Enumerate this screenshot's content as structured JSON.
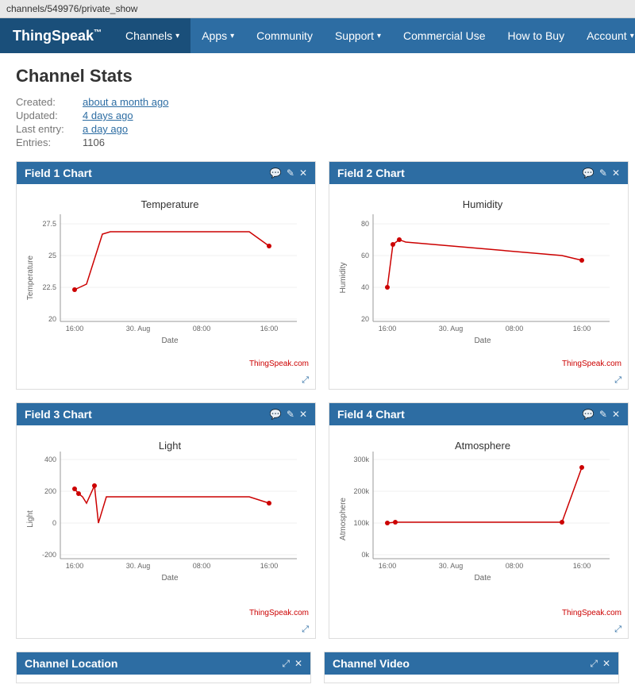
{
  "browser": {
    "url": "channels/549976/private_show"
  },
  "navbar": {
    "brand": "ThingSpeak",
    "brand_tm": "™",
    "items": [
      {
        "label": "Channels",
        "has_dropdown": true,
        "active": false
      },
      {
        "label": "Apps",
        "has_dropdown": true,
        "active": false
      },
      {
        "label": "Community",
        "has_dropdown": false,
        "active": false
      },
      {
        "label": "Support",
        "has_dropdown": true,
        "active": false
      }
    ],
    "right_items": [
      {
        "label": "Commercial Use",
        "has_dropdown": false
      },
      {
        "label": "How to Buy",
        "has_dropdown": false
      },
      {
        "label": "Account",
        "has_dropdown": true
      }
    ]
  },
  "page": {
    "title": "Channel Stats",
    "stats": [
      {
        "label": "Created:",
        "value": "about a month ago",
        "linked": true
      },
      {
        "label": "Updated:",
        "value": "4 days ago",
        "linked": true
      },
      {
        "label": "Last entry:",
        "value": "a day ago",
        "linked": true
      },
      {
        "label": "Entries:",
        "value": "1106",
        "linked": false
      }
    ]
  },
  "charts": [
    {
      "id": "field1",
      "title": "Field 1 Chart",
      "graph_title": "Temperature",
      "y_label": "Temperature",
      "x_label": "Date",
      "credit": "ThingSpeak.com",
      "y_ticks": [
        "27.5",
        "25",
        "22.5",
        "20"
      ],
      "x_ticks": [
        "16:00",
        "30. Aug",
        "08:00",
        "16:00"
      ],
      "data_points": [
        {
          "x": 60,
          "y": 285
        },
        {
          "x": 75,
          "y": 280
        },
        {
          "x": 110,
          "y": 250
        },
        {
          "x": 120,
          "y": 248
        },
        {
          "x": 315,
          "y": 248
        },
        {
          "x": 330,
          "y": 260
        }
      ]
    },
    {
      "id": "field2",
      "title": "Field 2 Chart",
      "graph_title": "Humidity",
      "y_label": "Humidity",
      "x_label": "Date",
      "credit": "ThingSpeak.com",
      "y_ticks": [
        "80",
        "60",
        "40",
        "20"
      ],
      "x_ticks": [
        "16:00",
        "30. Aug",
        "08:00",
        "16:00"
      ],
      "data_points": [
        {
          "x": 55,
          "y": 295
        },
        {
          "x": 65,
          "y": 240
        },
        {
          "x": 75,
          "y": 235
        },
        {
          "x": 80,
          "y": 238
        },
        {
          "x": 315,
          "y": 265
        },
        {
          "x": 330,
          "y": 265
        }
      ]
    },
    {
      "id": "field3",
      "title": "Field 3 Chart",
      "graph_title": "Light",
      "y_label": "Light",
      "x_label": "Date",
      "credit": "ThingSpeak.com",
      "y_ticks": [
        "400",
        "200",
        "0",
        "-200"
      ],
      "x_ticks": [
        "16:00",
        "30. Aug",
        "08:00",
        "16:00"
      ],
      "data_points": [
        {
          "x": 55,
          "y": 235
        },
        {
          "x": 65,
          "y": 205
        },
        {
          "x": 75,
          "y": 230
        },
        {
          "x": 80,
          "y": 232
        },
        {
          "x": 90,
          "y": 260
        },
        {
          "x": 95,
          "y": 290
        },
        {
          "x": 105,
          "y": 265
        },
        {
          "x": 315,
          "y": 265
        },
        {
          "x": 330,
          "y": 255
        }
      ]
    },
    {
      "id": "field4",
      "title": "Field 4 Chart",
      "graph_title": "Atmosphere",
      "y_label": "Atmosphere",
      "x_label": "Date",
      "credit": "ThingSpeak.com",
      "y_ticks": [
        "300k",
        "200k",
        "100k",
        "0k"
      ],
      "x_ticks": [
        "16:00",
        "30. Aug",
        "08:00",
        "16:00"
      ],
      "data_points": [
        {
          "x": 55,
          "y": 270
        },
        {
          "x": 70,
          "y": 268
        },
        {
          "x": 315,
          "y": 268
        },
        {
          "x": 330,
          "y": 195
        }
      ]
    }
  ],
  "bottom_cards": [
    {
      "title": "Channel Location"
    },
    {
      "title": "Channel Video"
    }
  ],
  "icons": {
    "comment": "💬",
    "edit": "✏",
    "close": "✕",
    "expand": "⤢",
    "trademark": "™"
  }
}
